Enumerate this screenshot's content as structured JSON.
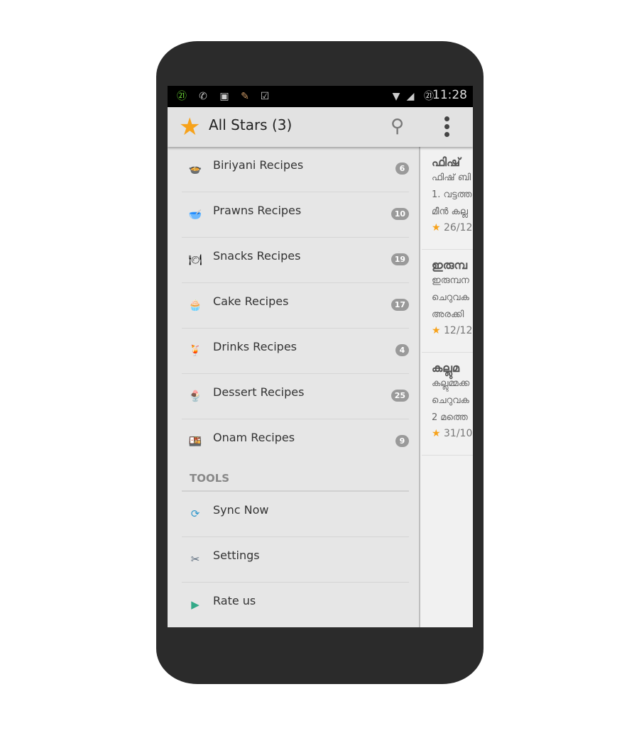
{
  "status_bar": {
    "time": "11:28",
    "notification_icons": [
      "badge-21-icon",
      "whatsapp-icon",
      "image-icon",
      "cleaner-icon",
      "briefcase-icon"
    ],
    "system_icons": [
      "wifi-icon",
      "signal-icon",
      "badge-21-icon"
    ]
  },
  "app_bar": {
    "title": "All Stars (3)",
    "icon": "star-icon",
    "actions": [
      "search-icon",
      "more-vert-icon"
    ]
  },
  "drawer": {
    "categories": [
      {
        "label": "Biriyani Recipes",
        "count": "6",
        "icon": "pot-icon"
      },
      {
        "label": "Prawns Recipes",
        "count": "10",
        "icon": "bowl-icon"
      },
      {
        "label": "Snacks Recipes",
        "count": "19",
        "icon": "plate-icon"
      },
      {
        "label": "Cake Recipes",
        "count": "17",
        "icon": "cupcake-icon"
      },
      {
        "label": "Drinks Recipes",
        "count": "4",
        "icon": "drink-icon"
      },
      {
        "label": "Dessert Recipes",
        "count": "25",
        "icon": "dessert-icon"
      },
      {
        "label": "Onam Recipes",
        "count": "9",
        "icon": "onam-icon"
      }
    ],
    "tools_header": "TOOLS",
    "tools": [
      {
        "label": "Sync Now",
        "icon": "sync-icon"
      },
      {
        "label": "Settings",
        "icon": "tools-icon"
      },
      {
        "label": "Rate us",
        "icon": "play-store-icon"
      }
    ]
  },
  "cards": [
    {
      "title": "ഫിഷ്",
      "lines": [
        "ഫിഷ് ബി",
        "1. വട്ടത്ത",
        "മീൻ കല്ല"
      ],
      "date": "26/12"
    },
    {
      "title": "ഇരുമ്പ",
      "lines": [
        "ഇരുമ്പന",
        "ചെറുവക",
        "അരക്കി"
      ],
      "date": "12/12"
    },
    {
      "title": "കല്ലുമ",
      "lines": [
        "കല്ലുമ്മക്ക",
        "ചെറുവക",
        "2 മത്തെ"
      ],
      "date": "31/10"
    }
  ],
  "colors": {
    "accent_star": "#f7a21a",
    "badge": "#9a9a9a",
    "app_bar": "#e2e2e2"
  }
}
